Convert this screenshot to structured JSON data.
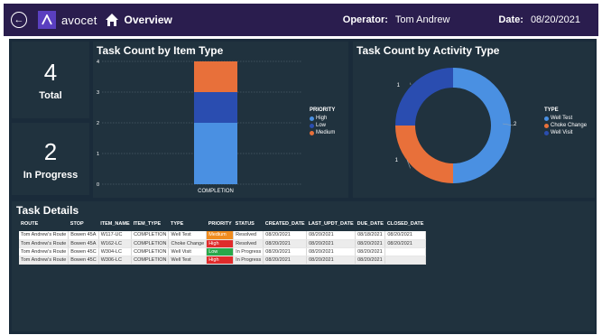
{
  "header": {
    "brand": "avocet",
    "page_title": "Overview",
    "operator_label": "Operator:",
    "operator_value": "Tom Andrew",
    "date_label": "Date:",
    "date_value": "08/20/2021"
  },
  "kpis": {
    "total_value": "4",
    "total_label": "Total",
    "in_progress_value": "2",
    "in_progress_label": "In Progress"
  },
  "item_chart": {
    "title": "Task Count by Item Type",
    "legend_title": "PRIORITY",
    "chart_data": {
      "type": "bar",
      "stacked": true,
      "categories": [
        "COMPLETION"
      ],
      "series": [
        {
          "name": "High",
          "values": [
            2
          ],
          "color": "#4a90e2"
        },
        {
          "name": "Low",
          "values": [
            1
          ],
          "color": "#2a4db0"
        },
        {
          "name": "Medium",
          "values": [
            1
          ],
          "color": "#e8703a"
        }
      ],
      "yticks": [
        0,
        1,
        2,
        3,
        4
      ],
      "ylim": [
        0,
        4
      ]
    }
  },
  "activity_chart": {
    "title": "Task Count by Activity Type",
    "legend_title": "TYPE",
    "chart_data": {
      "type": "pie",
      "donut": true,
      "labels": [
        "Well Test",
        "Choke Change",
        "Well Visit"
      ],
      "values": [
        2,
        1,
        1
      ],
      "colors": [
        "#4a90e2",
        "#e8703a",
        "#2a4db0"
      ],
      "data_labels": [
        "2",
        "1",
        "1"
      ]
    }
  },
  "table": {
    "title": "Task Details",
    "columns": [
      "ROUTE",
      "STOP",
      "ITEM_NAME",
      "ITEM_TYPE",
      "TYPE",
      "PRIORITY",
      "STATUS",
      "CREATED_DATE",
      "LAST_UPDT_DATE",
      "DUE_DATE",
      "CLOSED_DATE"
    ],
    "rows": [
      [
        "Tom Andrew's Route",
        "Bowen 45A",
        "W117-UC",
        "COMPLETION",
        "Well Test",
        "Medium",
        "Resolved",
        "08/20/2021",
        "08/20/2021",
        "08/18/2021",
        "08/20/2021"
      ],
      [
        "Tom Andrew's Route",
        "Bowen 45A",
        "W162-LC",
        "COMPLETION",
        "Choke Change",
        "High",
        "Resolved",
        "08/20/2021",
        "08/20/2021",
        "08/20/2021",
        "08/20/2021"
      ],
      [
        "Tom Andrew's Route",
        "Bowen 45C",
        "W304-LC",
        "COMPLETION",
        "Well Visit",
        "Low",
        "In Progress",
        "08/20/2021",
        "08/20/2021",
        "08/20/2021",
        ""
      ],
      [
        "Tom Andrew's Route",
        "Bowen 45C",
        "W306-LC",
        "COMPLETION",
        "Well Test",
        "High",
        "In Progress",
        "08/20/2021",
        "08/20/2021",
        "08/20/2021",
        ""
      ]
    ],
    "priority_colors": {
      "High": "#e02b2b",
      "Medium": "#f08c1e",
      "Low": "#29a84a"
    }
  }
}
